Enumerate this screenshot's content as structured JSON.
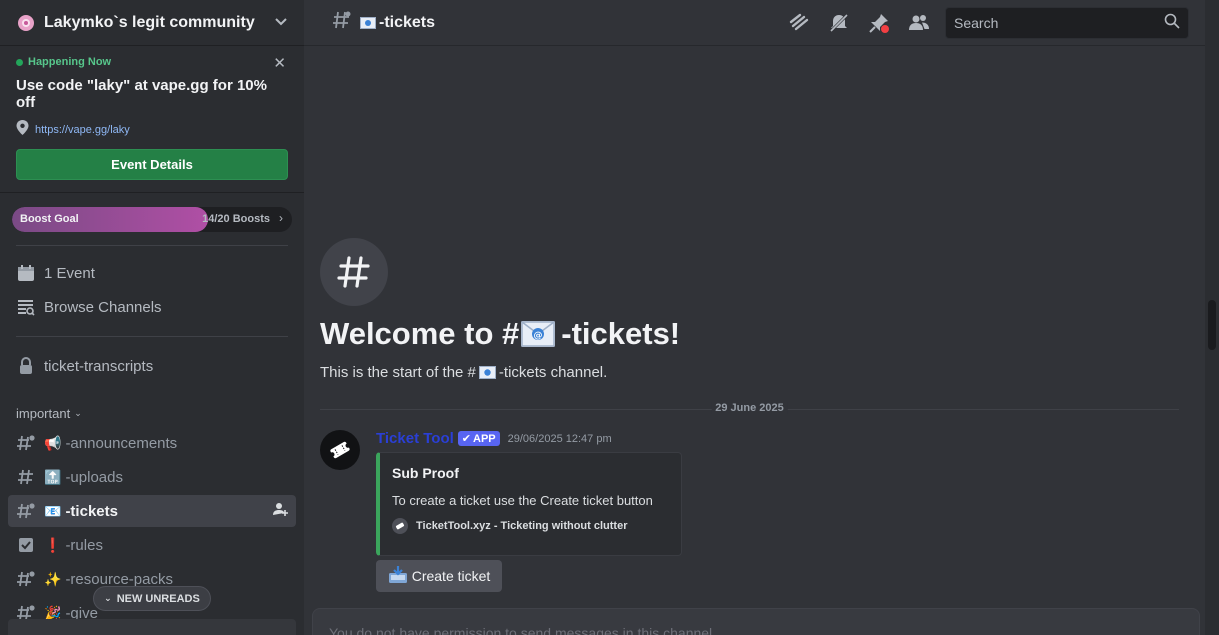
{
  "server": {
    "name": "Lakymko`s legit community"
  },
  "event": {
    "status": "Happening Now",
    "title": "Use code \"laky\" at vape.gg for 10% off",
    "link": "https://vape.gg/laky",
    "button_label": "Event Details"
  },
  "boost": {
    "label": "Boost Goal",
    "count": "14/20 Boosts",
    "progress": 0.7
  },
  "nav": {
    "events": "1 Event",
    "browse": "Browse Channels"
  },
  "locked_channel": "ticket-transcripts",
  "category": "important",
  "channels": [
    {
      "emoji": "📢",
      "name": "-announcements",
      "icon": "hash-thread-icon"
    },
    {
      "emoji": "🔝",
      "name": "-uploads",
      "icon": "hash-icon"
    },
    {
      "emoji": "📧",
      "name": "-tickets",
      "icon": "hash-thread-icon",
      "active": true
    },
    {
      "emoji": "❗",
      "name": "-rules",
      "icon": "rules-icon"
    },
    {
      "emoji": "✨",
      "name": "-resource-packs",
      "icon": "hash-thread-icon"
    },
    {
      "emoji": "🎉",
      "name": "-give",
      "icon": "hash-thread-icon"
    }
  ],
  "unreads_label": "NEW UNREADS",
  "topbar": {
    "channel": "-tickets",
    "search_placeholder": "Search"
  },
  "welcome": {
    "title_prefix": "Welcome to #",
    "title_suffix": "-tickets!",
    "sub_prefix": "This is the start of the #",
    "sub_suffix": "-tickets channel."
  },
  "divider_date": "29 June 2025",
  "message": {
    "author": "Ticket Tool",
    "badge": "APP",
    "timestamp": "29/06/2025 12:47 pm",
    "embed": {
      "title": "Sub Proof",
      "description": "To create a ticket use the Create ticket button",
      "footer": "TicketTool.xyz - Ticketing without clutter"
    },
    "button_label": "Create ticket"
  },
  "composer_text": "You do not have permission to send messages in this channel.",
  "colors": {
    "accent_green": "#248046",
    "author_blue": "#2a3fd6",
    "embed_border": "#3ba55c",
    "app_badge": "#5865f2"
  }
}
